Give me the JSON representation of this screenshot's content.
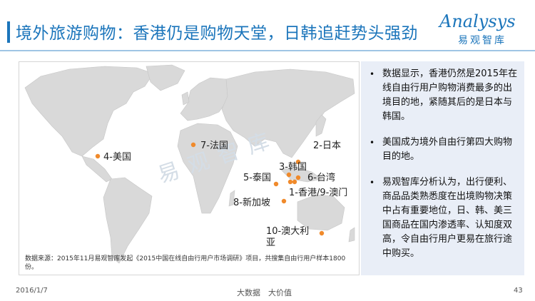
{
  "header": {
    "title": "境外旅游购物：香港仍是购物天堂，日韩追赶势头强劲",
    "logo_main": "Analysys",
    "logo_sub": "易观智库"
  },
  "map": {
    "watermark": "易观智库",
    "source_note": "数据来源：2015年11月易观智库发起《2015中国在线自由行用户市场调研》项目，共搜集自由行用户样本1800份。",
    "marker_color": "#f08a2b",
    "markers": [
      {
        "label": "4-美国"
      },
      {
        "label": "7-法国"
      },
      {
        "label": "2-日本"
      },
      {
        "label": "3-韩国"
      },
      {
        "label": "5-泰国"
      },
      {
        "label": "6-台湾"
      },
      {
        "label": "1-香港/9-澳门"
      },
      {
        "label": "8-新加坡"
      },
      {
        "label": "10-澳大利亚"
      }
    ]
  },
  "notes": {
    "bullets": [
      "数据显示，香港仍然是2015年在线自由行用户购物消费最多的出境目的地，紧随其后的是日本与韩国。",
      "美国成为境外自由行第四大购物目的地。",
      "易观智库分析认为，出行便利、商品品类熟悉度在出境购物决策中占有重要地位，日、韩、美三国商品在国内渗透率、认知度双高，令自由行用户更易在旅行途中购买。"
    ]
  },
  "footer": {
    "date": "2016/1/7",
    "center": "大数据　大价值",
    "page": "43"
  }
}
